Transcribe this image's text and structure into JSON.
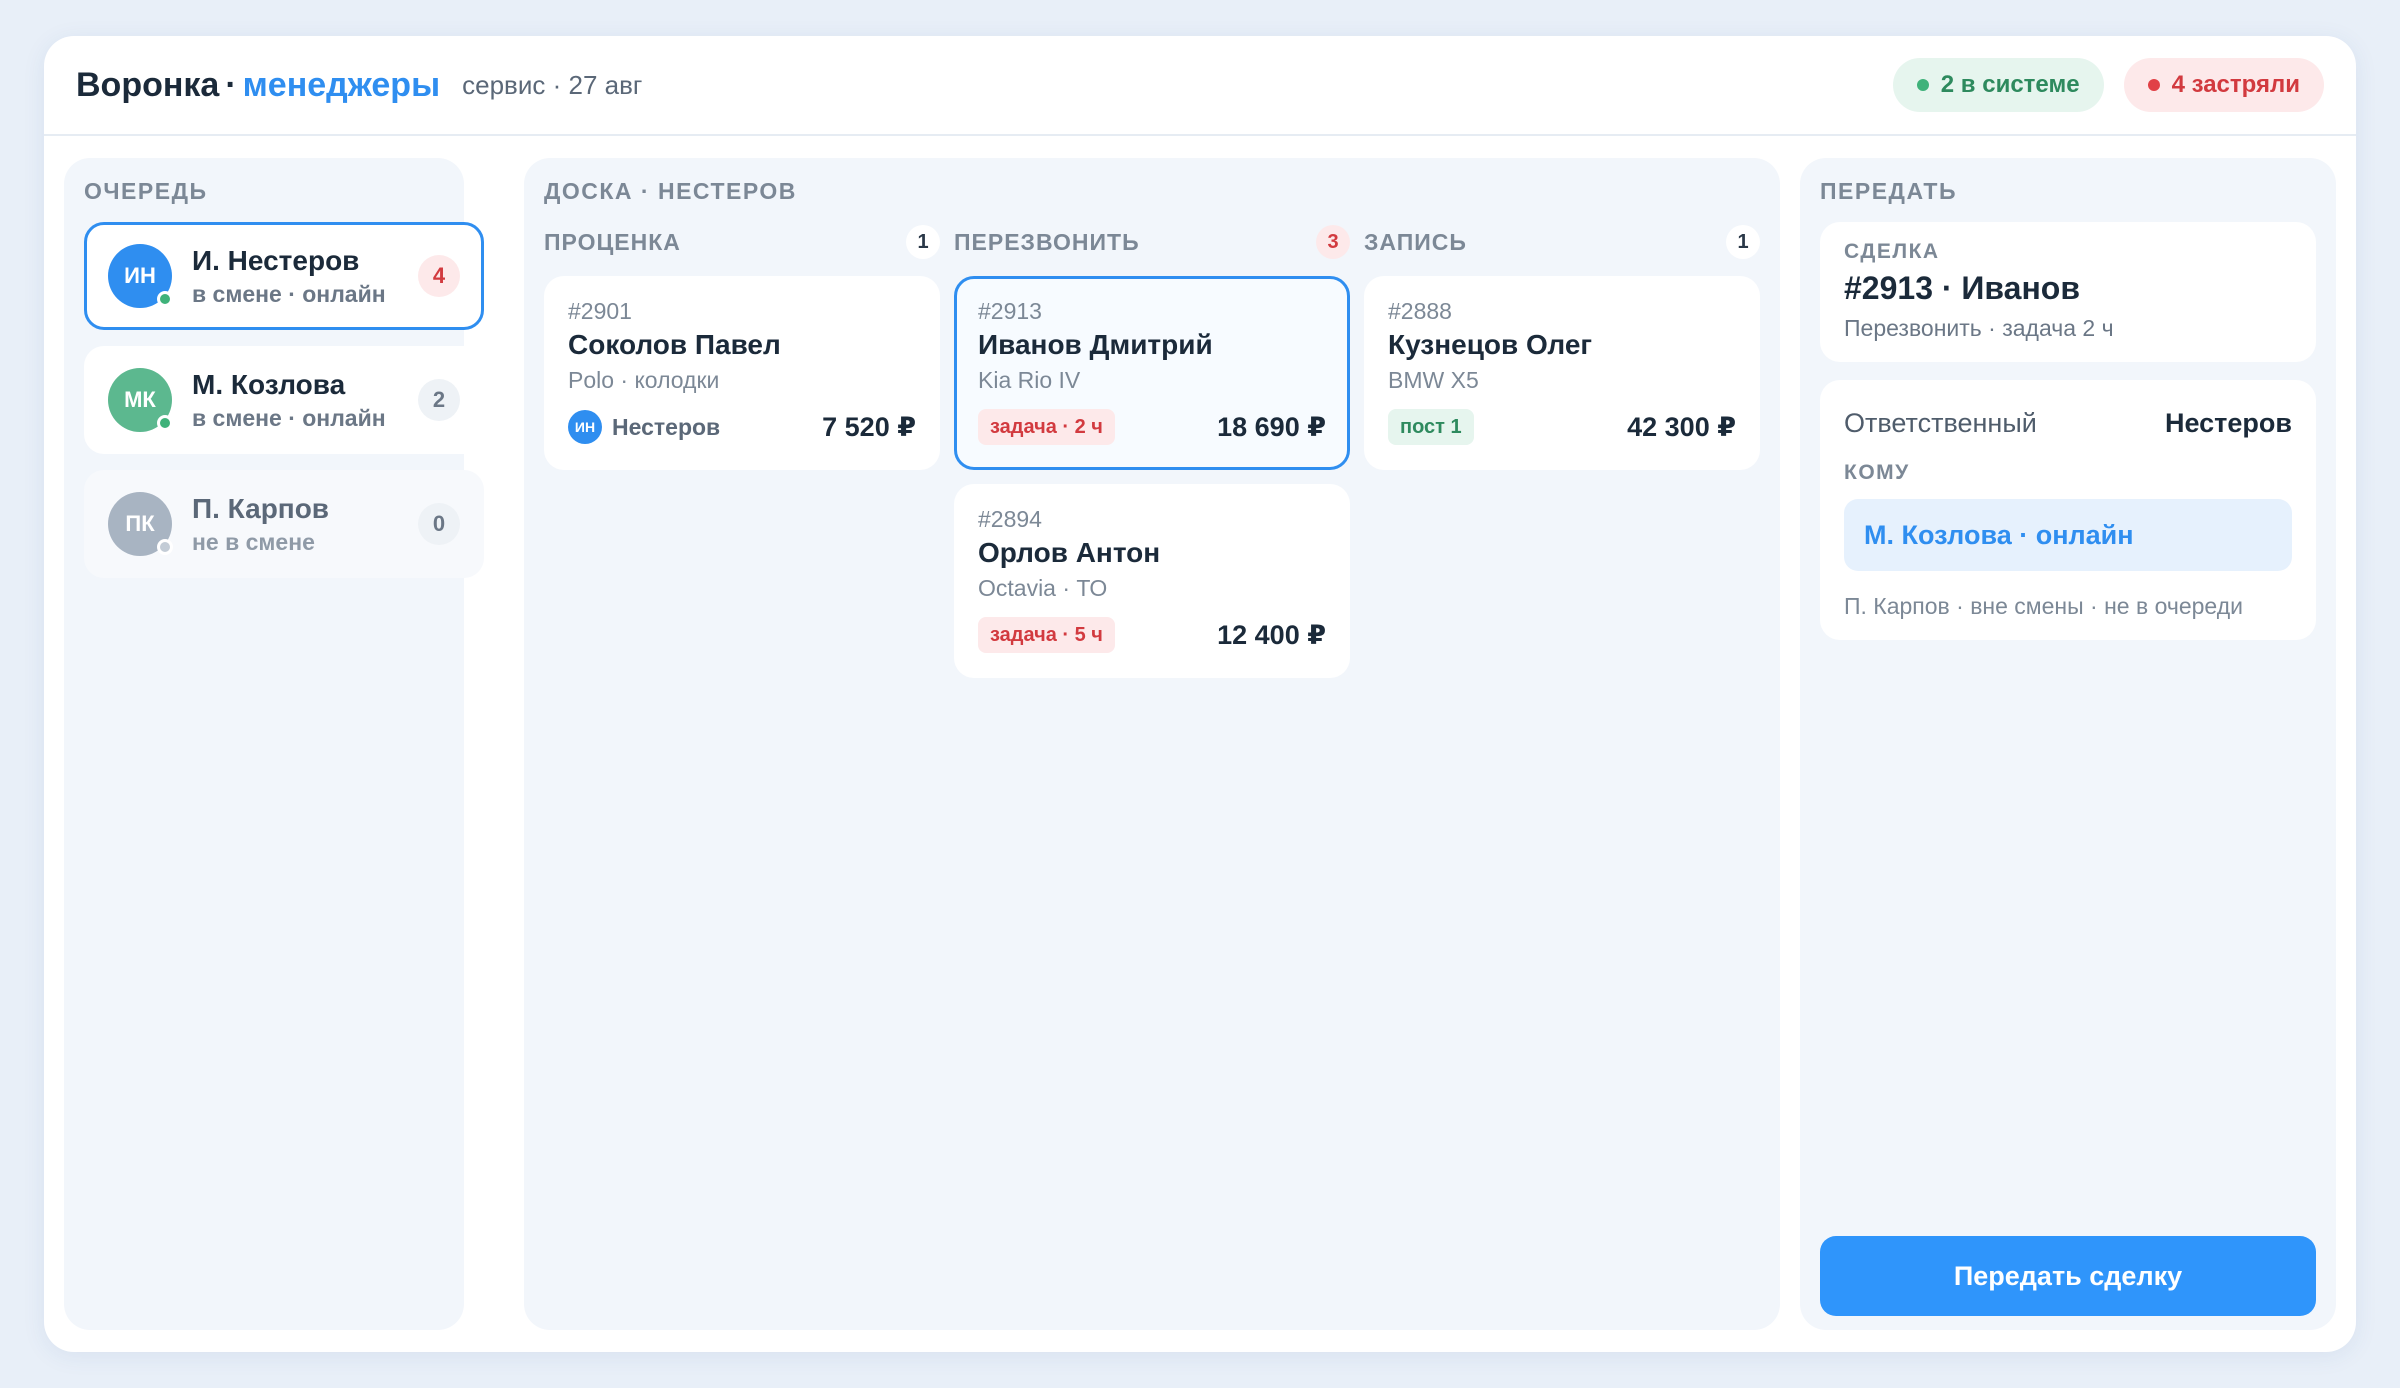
{
  "header": {
    "title_main": "Воронка",
    "title_dot": "·",
    "title_accent": "менеджеры",
    "subtitle": "сервис · 27 авг",
    "chip_ok": "2 в системе",
    "chip_bad": "4 застряли"
  },
  "queue": {
    "label": "ОЧЕРЕДЬ",
    "items": [
      {
        "initials": "ИН",
        "name": "И. Нестеров",
        "status": "в смене · онлайн",
        "count": "4",
        "avatar_color": "#2f8ef0",
        "dot_color": "#3fb27a"
      },
      {
        "initials": "МК",
        "name": "М. Козлова",
        "status": "в смене · онлайн",
        "count": "2",
        "avatar_color": "#5cb88f",
        "dot_color": "#3fb27a"
      },
      {
        "initials": "ПК",
        "name": "П. Карпов",
        "status": "не в смене",
        "count": "0",
        "avatar_color": "#a8b4c2",
        "dot_color": "#c3ccd6"
      }
    ]
  },
  "board": {
    "label": "ДОСКА · НЕСТЕРОВ",
    "columns": [
      {
        "name": "ПРОЦЕНКА",
        "count": "1"
      },
      {
        "name": "ПЕРЕЗВОНИТЬ",
        "count": "3"
      },
      {
        "name": "ЗАПИСЬ",
        "count": "1"
      }
    ],
    "deals": [
      {
        "id": "#2901",
        "client": "Соколов Павел",
        "car": "Polo · колодки",
        "owner_initials": "ИН",
        "owner": "Нестеров",
        "amount": "7 520 ₽"
      },
      {
        "id": "#2913",
        "client": "Иванов Дмитрий",
        "car": "Kia Rio IV",
        "tag": "задача · 2 ч",
        "amount": "18 690 ₽"
      },
      {
        "id": "#2894",
        "client": "Орлов Антон",
        "car": "Octavia · ТО",
        "tag": "задача · 5 ч",
        "amount": "12 400 ₽"
      },
      {
        "id": "#2888",
        "client": "Кузнецов Олег",
        "car": "BMW X5",
        "tag": "пост 1",
        "amount": "42 300 ₽"
      }
    ]
  },
  "transfer": {
    "label": "ПЕРЕДАТЬ",
    "deal_label": "СДЕЛКА",
    "deal_title": "#2913 · Иванов",
    "deal_sub": "Перезвонить · задача 2 ч",
    "resp_label": "Ответственный",
    "resp_value": "Нестеров",
    "to_label": "КОМУ",
    "target": "М. Козлова · онлайн",
    "note": "П. Карпов · вне смены · не в очереди",
    "button": "Передать сделку"
  }
}
